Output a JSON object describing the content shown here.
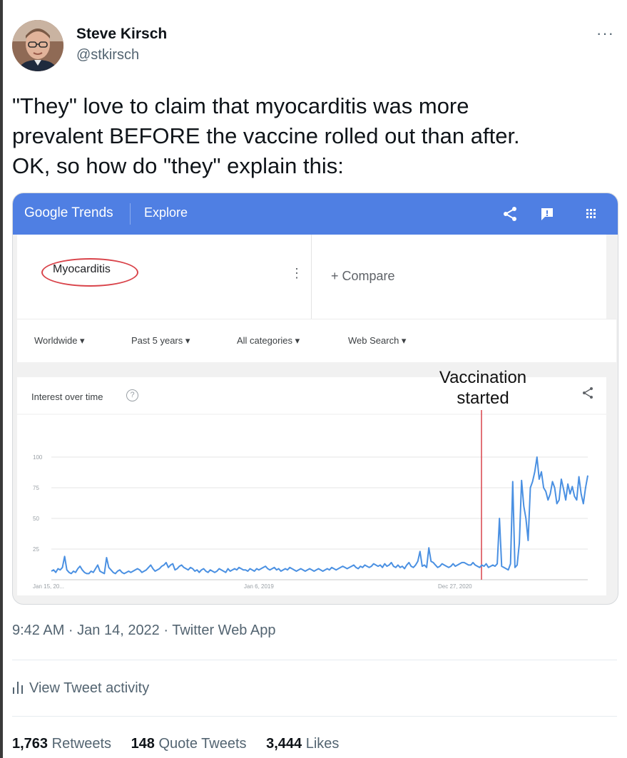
{
  "author": {
    "name": "Steve Kirsch",
    "handle": "@stkirsch",
    "more_label": "···"
  },
  "tweet": {
    "lines": [
      "\"They\" love to claim that myocarditis was more",
      "prevalent BEFORE the vaccine rolled out than after.",
      "OK, so how do \"they\" explain this:"
    ]
  },
  "trends": {
    "logo": "Google Trends",
    "explore": "Explore",
    "header_icons": [
      "share-icon",
      "feedback-icon",
      "apps-icon"
    ],
    "term": "Myocarditis",
    "term_menu": "⋮",
    "compare": "+  Compare",
    "filters": [
      "Worldwide ▾",
      "Past 5 years ▾",
      "All categories ▾",
      "Web Search ▾"
    ],
    "chart_title": "Interest over time",
    "help": "?",
    "annotation": [
      "Vaccination",
      "started"
    ],
    "colors": {
      "header": "#4f7fe3",
      "line": "#4a90e2",
      "marker": "#d9434a"
    }
  },
  "chart_data": {
    "type": "line",
    "title": "Interest over time",
    "x_tick_labels": [
      "Jan 15, 20...",
      "Jan 6, 2019",
      "Dec 27, 2020"
    ],
    "y_tick_labels": [
      "100",
      "75",
      "50",
      "25"
    ],
    "ylim": [
      0,
      100
    ],
    "grid": true,
    "annotation": {
      "label": "Vaccination started",
      "x": "Dec 27, 2020"
    },
    "series": [
      {
        "values": [
          7,
          8,
          6,
          9,
          8,
          10,
          19,
          8,
          6,
          5,
          7,
          6,
          9,
          11,
          8,
          6,
          5,
          5,
          7,
          6,
          9,
          12,
          7,
          6,
          5,
          18,
          10,
          8,
          6,
          5,
          7,
          8,
          6,
          5,
          6,
          7,
          6,
          7,
          8,
          9,
          8,
          6,
          7,
          8,
          10,
          12,
          9,
          7,
          8,
          9,
          11,
          12,
          14,
          10,
          12,
          13,
          8,
          9,
          11,
          12,
          10,
          9,
          8,
          10,
          9,
          7,
          8,
          6,
          8,
          9,
          7,
          6,
          8,
          7,
          6,
          7,
          9,
          8,
          7,
          6,
          9,
          7,
          8,
          9,
          8,
          10,
          9,
          8,
          8,
          7,
          9,
          8,
          7,
          9,
          8,
          9,
          10,
          11,
          9,
          8,
          9,
          10,
          8,
          9,
          7,
          8,
          9,
          8,
          10,
          9,
          8,
          7,
          8,
          9,
          8,
          7,
          8,
          9,
          8,
          7,
          8,
          9,
          8,
          7,
          8,
          9,
          8,
          10,
          9,
          8,
          9,
          10,
          11,
          10,
          9,
          10,
          11,
          12,
          10,
          9,
          11,
          10,
          12,
          11,
          10,
          11,
          13,
          12,
          11,
          12,
          10,
          13,
          11,
          12,
          14,
          11,
          10,
          12,
          10,
          11,
          9,
          12,
          14,
          11,
          10,
          12,
          15,
          23,
          11,
          12,
          10,
          26,
          15,
          14,
          12,
          10,
          11,
          13,
          12,
          11,
          10,
          11,
          13,
          11,
          12,
          13,
          14,
          14,
          13,
          12,
          12,
          14,
          12,
          11,
          10,
          12,
          11,
          13,
          10,
          11,
          12,
          11,
          13,
          50,
          11,
          10,
          9,
          8,
          13,
          80,
          10,
          12,
          30,
          81,
          60,
          50,
          32,
          75,
          80,
          88,
          100,
          82,
          88,
          75,
          72,
          65,
          70,
          80,
          75,
          62,
          65,
          82,
          74,
          65,
          78,
          70,
          76,
          68,
          65,
          84,
          70,
          62,
          75,
          85
        ]
      }
    ]
  },
  "timestamp": "9:42 AM · Jan 14, 2022 · Twitter Web App",
  "activity": {
    "icon": "analytics-icon",
    "label": "View Tweet activity"
  },
  "stats": [
    {
      "count": "1,763",
      "label": "Retweets"
    },
    {
      "count": "148",
      "label": "Quote Tweets"
    },
    {
      "count": "3,444",
      "label": "Likes"
    }
  ]
}
